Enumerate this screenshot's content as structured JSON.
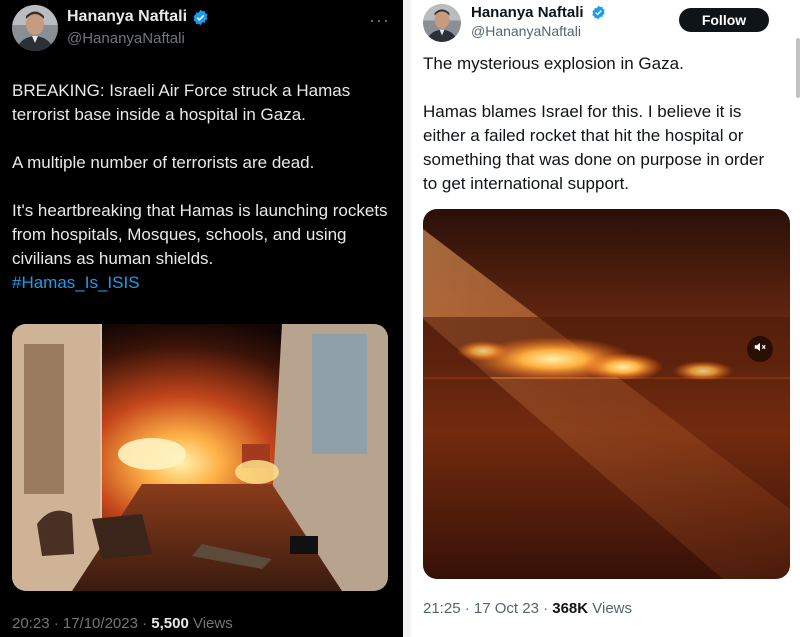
{
  "left_tweet": {
    "author_name": "Hananya Naftali",
    "handle": "@HananyaNaftali",
    "more_icon": "more-horizontal-icon",
    "paragraphs": [
      "BREAKING: Israeli Air Force struck a Hamas terrorist base inside a hospital in Gaza.",
      "A multiple number of terrorists are dead.",
      "It's heartbreaking that Hamas is launching rockets from hospitals, Mosques, schools, and using civilians as human shields."
    ],
    "hashtag": "#Hamas_Is_ISIS",
    "timestamp": "20:23 · 17/10/2023 · ",
    "views_count": "5,500",
    "views_label": " Views"
  },
  "right_tweet": {
    "author_name": "Hananya Naftali",
    "handle": "@HananyaNaftali",
    "follow_label": "Follow",
    "paragraphs": [
      "The mysterious explosion in Gaza.",
      "Hamas blames Israel for this. I believe it is either a failed rocket that hit the hospital or something that was done on purpose in order to get international support."
    ],
    "mute_icon": "speaker-muted-icon",
    "timestamp": "21:25 · 17 Oct 23 · ",
    "views_count": "368K",
    "views_label": " Views"
  },
  "colors": {
    "dark_bg": "#000000",
    "dark_text": "#e7e9ea",
    "muted_text": "#71767b",
    "link_blue": "#1d9bf0",
    "verified_blue": "#1d9bf0",
    "light_bg": "#ffffff"
  }
}
